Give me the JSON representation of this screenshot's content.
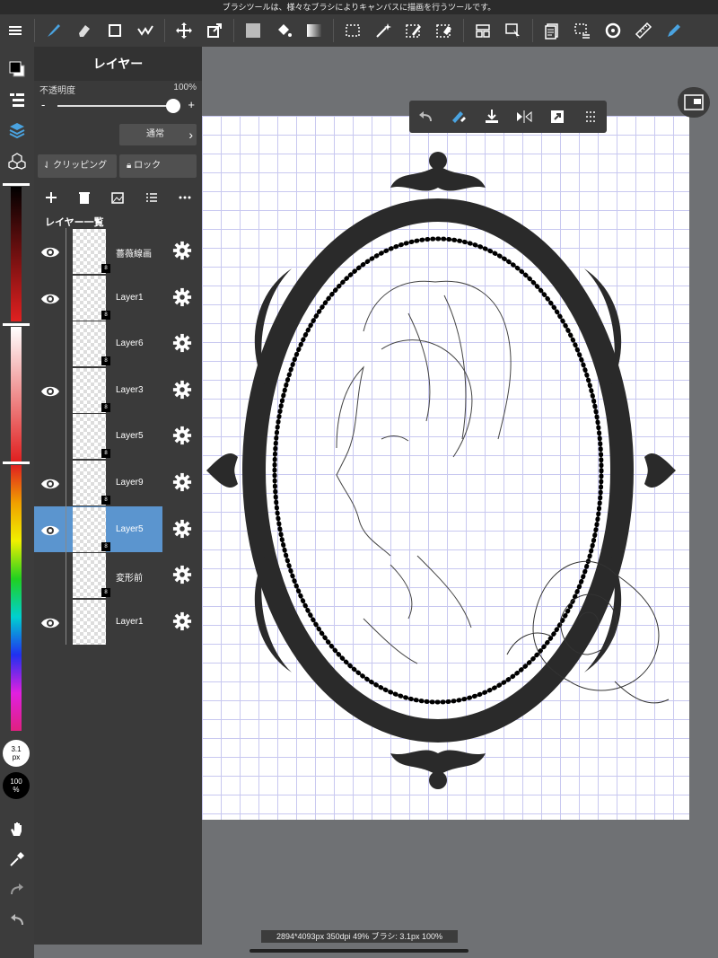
{
  "tip": "ブラシツールは、様々なブラシによりキャンバスに描画を行うツールです。",
  "panel": {
    "title": "レイヤー",
    "opacity_label": "不透明度",
    "opacity_value": "100%",
    "opacity_level": 1.0,
    "minus": "-",
    "plus": "+",
    "blend_mode": "通常",
    "clipping": "クリッピング",
    "lock": "ロック",
    "list_title": "レイヤー一覧"
  },
  "layers": [
    {
      "name": "薔薇線画",
      "visible": true,
      "badge": "8",
      "selected": false
    },
    {
      "name": "Layer1",
      "visible": true,
      "badge": "8",
      "selected": false
    },
    {
      "name": "Layer6",
      "visible": false,
      "badge": "8",
      "selected": false
    },
    {
      "name": "Layer3",
      "visible": true,
      "badge": "8",
      "selected": false
    },
    {
      "name": "Layer5",
      "visible": false,
      "badge": "8",
      "selected": false
    },
    {
      "name": "Layer9",
      "visible": true,
      "badge": "8",
      "selected": false
    },
    {
      "name": "Layer5",
      "visible": true,
      "badge": "8",
      "selected": true
    },
    {
      "name": "変形前",
      "visible": false,
      "badge": "8",
      "selected": false
    },
    {
      "name": "Layer1",
      "visible": true,
      "badge": "",
      "selected": false
    }
  ],
  "rail": {
    "brush_size": "3.1",
    "brush_unit": "px",
    "opacity": "100",
    "opacity_unit": "%"
  },
  "status_bar": "2894*4093px 350dpi 49% ブラシ: 3.1px 100%",
  "colors": {
    "accent": "#4aa3e0",
    "selected_layer": "#5b95cf",
    "toolbar": "#3c3c3c",
    "background": "#6f7174"
  }
}
